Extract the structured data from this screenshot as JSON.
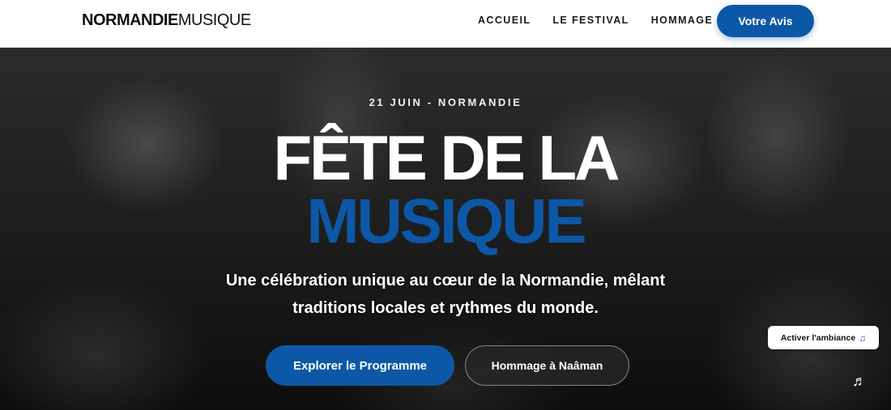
{
  "header": {
    "logo_bold": "NORMANDIE",
    "logo_light": "MUSIQUE",
    "nav": [
      "ACCUEIL",
      "LE FESTIVAL",
      "HOMMAGE"
    ],
    "cta_label": "Votre Avis"
  },
  "hero": {
    "eyebrow": "21 JUIN - NORMANDIE",
    "title_line1": "FÊTE DE LA",
    "title_line2": "MUSIQUE",
    "subtitle": "Une célébration unique au cœur de la Normandie, mêlant traditions locales et rythmes du monde.",
    "primary_button": "Explorer le Programme",
    "secondary_button": "Hommage à Naâman"
  },
  "ambiance": {
    "label": "Activer l'ambiance",
    "icon": "music-note-icon"
  },
  "colors": {
    "accent": "#0d58a6",
    "text_dark": "#111111",
    "white": "#ffffff"
  }
}
